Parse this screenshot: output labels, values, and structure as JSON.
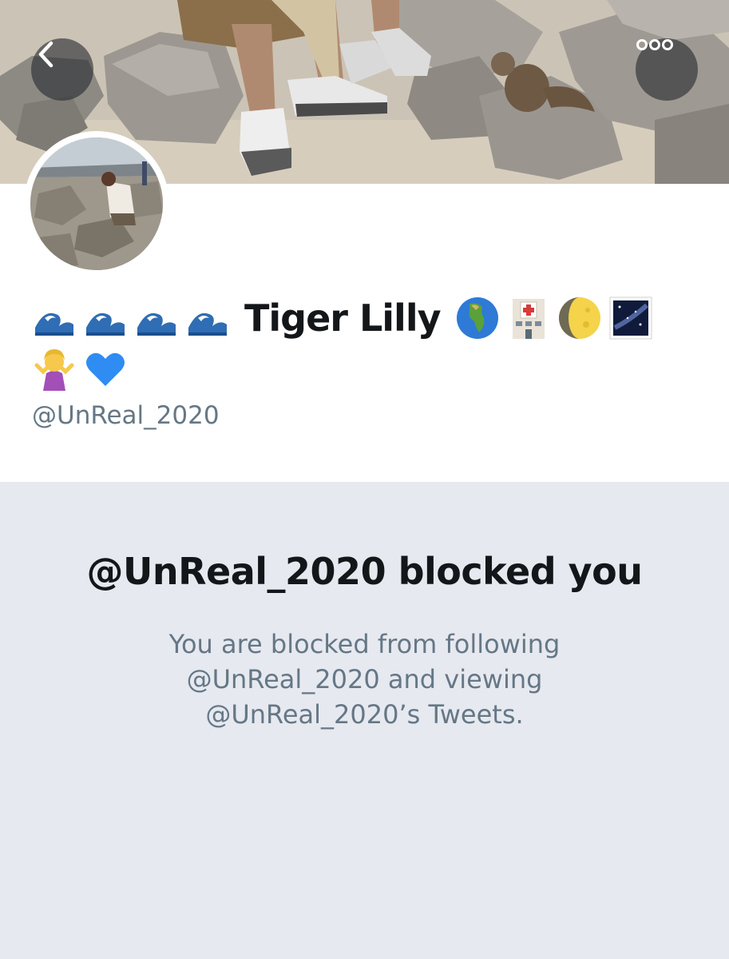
{
  "header": {
    "back_icon": "chevron-left-icon",
    "more_icon": "more-horizontal-icon"
  },
  "profile": {
    "name_prefix_emojis": [
      "water-wave-emoji",
      "water-wave-emoji",
      "water-wave-emoji",
      "water-wave-emoji"
    ],
    "display_name": "Tiger Lilly",
    "name_suffix_emojis": [
      "globe-africa-europe-emoji",
      "hospital-emoji",
      "moon-emoji",
      "milky-way-emoji",
      "person-shrugging-emoji",
      "blue-heart-emoji"
    ],
    "handle": "@UnReal_2020"
  },
  "blocked": {
    "title": "@UnReal_2020 blocked you",
    "message": "You are blocked from following @UnReal_2020 and viewing @UnReal_2020’s Tweets."
  },
  "colors": {
    "panel_bg": "#e6e9ef",
    "primary_text": "#14171a",
    "secondary_text": "#657786"
  }
}
